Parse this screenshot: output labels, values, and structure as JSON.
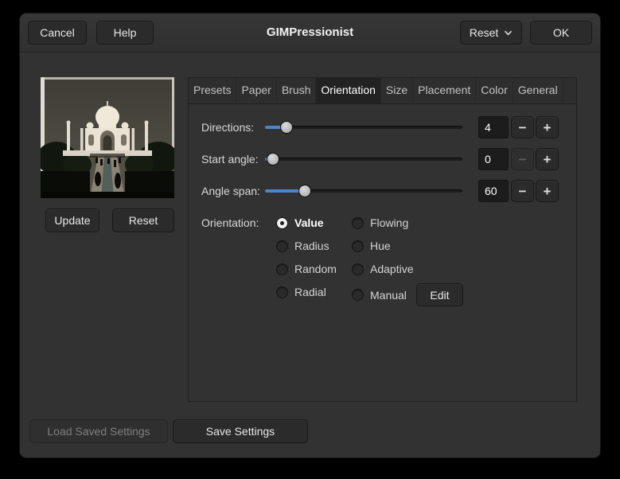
{
  "window": {
    "title": "GIMPressionist"
  },
  "header": {
    "cancel": "Cancel",
    "help": "Help",
    "reset": "Reset",
    "ok": "OK"
  },
  "preview": {
    "update": "Update",
    "reset": "Reset"
  },
  "notebook": {
    "tabs": [
      "Presets",
      "Paper",
      "Brush",
      "Orientation",
      "Size",
      "Placement",
      "Color",
      "General"
    ],
    "active_tab": "Orientation"
  },
  "orientation": {
    "sliders": [
      {
        "label": "Directions:",
        "value": "4",
        "percent": 11,
        "minus_enabled": true
      },
      {
        "label": "Start angle:",
        "value": "0",
        "percent": 4,
        "minus_enabled": false
      },
      {
        "label": "Angle span:",
        "value": "60",
        "percent": 20,
        "minus_enabled": true
      }
    ],
    "label": "Orientation:",
    "options": [
      {
        "label": "Value",
        "selected": true
      },
      {
        "label": "Flowing",
        "selected": false
      },
      {
        "label": "Radius",
        "selected": false
      },
      {
        "label": "Hue",
        "selected": false
      },
      {
        "label": "Random",
        "selected": false
      },
      {
        "label": "Adaptive",
        "selected": false
      },
      {
        "label": "Radial",
        "selected": false
      },
      {
        "label": "Manual",
        "selected": false
      }
    ],
    "edit": "Edit"
  },
  "glyphs": {
    "minus": "−",
    "plus": "+"
  },
  "footer": {
    "load": "Load Saved Settings",
    "load_enabled": false,
    "save": "Save Settings"
  },
  "colors": {
    "outer_bg": "#000000",
    "window_bg": "#323232",
    "accent": "#4a86c8"
  }
}
